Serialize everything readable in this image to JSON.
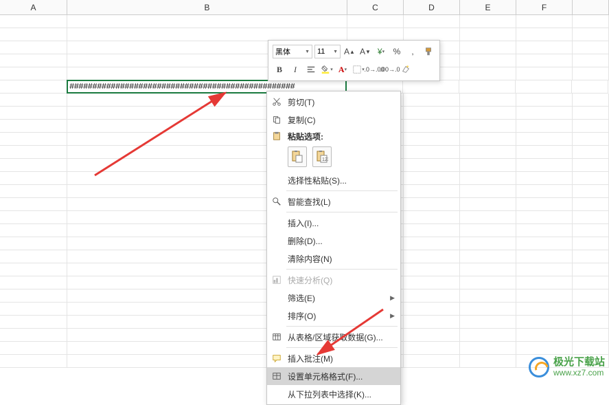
{
  "columns": [
    "A",
    "B",
    "C",
    "D",
    "E",
    "F"
  ],
  "selected_cell_value": "#################################################",
  "mini_toolbar": {
    "font_name": "黑体",
    "font_size": "11",
    "percent": "%",
    "comma": ",",
    "bold": "B",
    "italic": "I"
  },
  "context_menu": {
    "cut": "剪切(T)",
    "copy": "复制(C)",
    "paste_options_label": "粘贴选项:",
    "paste_special": "选择性粘贴(S)...",
    "smart_lookup": "智能查找(L)",
    "insert": "插入(I)...",
    "delete": "删除(D)...",
    "clear": "清除内容(N)",
    "quick_analysis": "快速分析(Q)",
    "filter": "筛选(E)",
    "sort": "排序(O)",
    "get_data": "从表格/区域获取数据(G)...",
    "insert_comment": "插入批注(M)",
    "format_cells": "设置单元格格式(F)...",
    "pick_from_list": "从下拉列表中选择(K)..."
  },
  "watermark": {
    "site_name": "极光下载站",
    "url": "www.xz7.com"
  }
}
